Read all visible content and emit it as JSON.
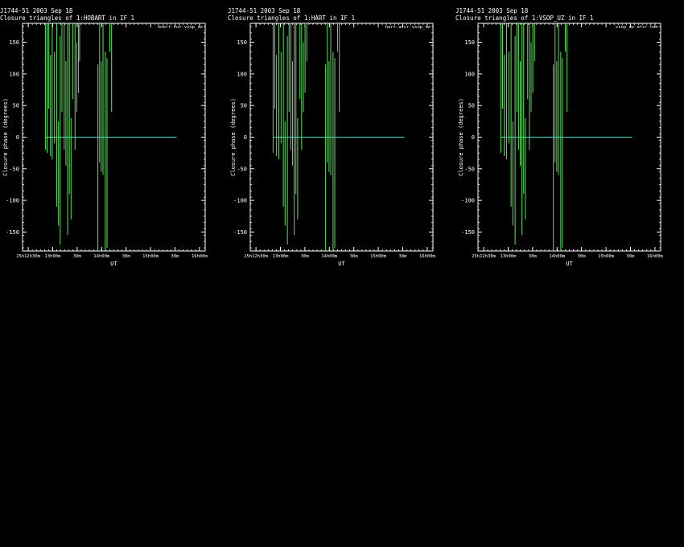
{
  "charts": [
    {
      "source": "J1744-51  2003 Sep 18",
      "title": "Closure triangles of 1:HOBART in IF 1",
      "triangle": "hobrt-rut-vsop_uz"
    },
    {
      "source": "J1744-51  2003 Sep 18",
      "title": "Closure triangles of 1:HART in IF 1",
      "triangle": "hart-atcr-vsop_uz"
    },
    {
      "source": "J1744-51  2003 Sep 18",
      "title": "Closure triangles of 1:VSOP_UZ in IF 1",
      "triangle": "vsop_uz-atcr-hun"
    }
  ],
  "chart_data": [
    {
      "type": "line",
      "xlabel": "UT",
      "ylabel": "Closure phase  (degrees)",
      "x_tick_labels": [
        "25h12h30m",
        "13h00m",
        "30m",
        "14h00m",
        "30m",
        "15h00m",
        "30m",
        "16h00m"
      ],
      "y_ticks": [
        150,
        100,
        50,
        0,
        -50,
        -100,
        -150
      ],
      "ylim": [
        -180,
        180
      ],
      "xlim": [
        -0.1,
        3.1
      ],
      "model_line": {
        "x": [
          0.3,
          2.6
        ],
        "y": [
          0,
          0
        ],
        "color": "#40e0d0"
      },
      "series": [
        {
          "color": "#5ce05c",
          "segments": [
            [
              0.3,
              -20,
              180
            ],
            [
              0.33,
              180,
              -25
            ],
            [
              0.36,
              45,
              180
            ],
            [
              0.39,
              130,
              -30
            ],
            [
              0.42,
              180,
              -35
            ],
            [
              0.46,
              135,
              -10
            ],
            [
              0.5,
              180,
              -110
            ],
            [
              0.53,
              25,
              -140
            ],
            [
              0.56,
              160,
              -170
            ],
            [
              0.59,
              180,
              40
            ],
            [
              0.63,
              180,
              -20
            ],
            [
              0.66,
              120,
              -45
            ],
            [
              0.69,
              180,
              -155
            ],
            [
              0.72,
              180,
              -90
            ],
            [
              0.75,
              30,
              -130
            ],
            [
              0.78,
              180,
              60
            ],
            [
              0.82,
              180,
              -20
            ],
            [
              0.85,
              150,
              40
            ],
            [
              0.88,
              180,
              70
            ],
            [
              0.9,
              180,
              120
            ],
            [
              1.22,
              115,
              -180
            ],
            [
              1.25,
              -40,
              180
            ],
            [
              1.28,
              120,
              -55
            ],
            [
              1.31,
              -60,
              180
            ],
            [
              1.35,
              135,
              -180
            ],
            [
              1.38,
              125,
              -175
            ],
            [
              1.43,
              135,
              180
            ],
            [
              1.46,
              180,
              40
            ]
          ]
        }
      ]
    },
    {
      "type": "line",
      "xlabel": "UT",
      "ylabel": "Closure phase  (degrees)",
      "x_tick_labels": [
        "25h12h30m",
        "13h00m",
        "30m",
        "14h00m",
        "30m",
        "15h00m",
        "30m",
        "16h00m"
      ],
      "y_ticks": [
        150,
        100,
        50,
        0,
        -50,
        -100,
        -150
      ],
      "ylim": [
        -180,
        180
      ],
      "xlim": [
        -0.1,
        3.1
      ],
      "model_line": {
        "x": [
          0.3,
          2.6
        ],
        "y": [
          0,
          0
        ],
        "color": "#40e0d0"
      },
      "series": [
        {
          "color": "#5ce05c",
          "segments": [
            [
              0.3,
              180,
              -25
            ],
            [
              0.33,
              45,
              180
            ],
            [
              0.36,
              130,
              -30
            ],
            [
              0.4,
              180,
              -35
            ],
            [
              0.44,
              135,
              -10
            ],
            [
              0.48,
              180,
              -110
            ],
            [
              0.51,
              25,
              -140
            ],
            [
              0.55,
              160,
              -170
            ],
            [
              0.58,
              180,
              40
            ],
            [
              0.61,
              180,
              -20
            ],
            [
              0.64,
              120,
              -45
            ],
            [
              0.67,
              180,
              -155
            ],
            [
              0.7,
              180,
              -90
            ],
            [
              0.73,
              30,
              -130
            ],
            [
              0.77,
              180,
              60
            ],
            [
              0.8,
              180,
              -20
            ],
            [
              0.83,
              150,
              40
            ],
            [
              0.86,
              180,
              70
            ],
            [
              0.89,
              180,
              120
            ],
            [
              1.22,
              115,
              -180
            ],
            [
              1.25,
              -40,
              180
            ],
            [
              1.28,
              120,
              -55
            ],
            [
              1.31,
              -60,
              180
            ],
            [
              1.35,
              135,
              -180
            ],
            [
              1.38,
              125,
              -175
            ],
            [
              1.43,
              135,
              180
            ],
            [
              1.46,
              180,
              40
            ]
          ]
        }
      ]
    },
    {
      "type": "line",
      "xlabel": "UT",
      "ylabel": "Closure phase  (degrees)",
      "x_tick_labels": [
        "25h12h30m",
        "13h00m",
        "30m",
        "14h00m",
        "30m",
        "15h00m",
        "30m",
        "16h00m"
      ],
      "y_ticks": [
        150,
        100,
        50,
        0,
        -50,
        -100,
        -150
      ],
      "ylim": [
        -180,
        180
      ],
      "xlim": [
        -0.1,
        3.1
      ],
      "model_line": {
        "x": [
          0.3,
          2.6
        ],
        "y": [
          0,
          0
        ],
        "color": "#40e0d0"
      },
      "series": [
        {
          "color": "#5ce05c",
          "segments": [
            [
              0.3,
              180,
              -25
            ],
            [
              0.33,
              45,
              180
            ],
            [
              0.36,
              130,
              -30
            ],
            [
              0.4,
              180,
              -35
            ],
            [
              0.44,
              135,
              -10
            ],
            [
              0.48,
              180,
              -110
            ],
            [
              0.51,
              25,
              -140
            ],
            [
              0.55,
              160,
              -170
            ],
            [
              0.58,
              180,
              40
            ],
            [
              0.61,
              180,
              -20
            ],
            [
              0.64,
              120,
              -45
            ],
            [
              0.67,
              180,
              -155
            ],
            [
              0.7,
              180,
              -90
            ],
            [
              0.73,
              30,
              -130
            ],
            [
              0.77,
              180,
              60
            ],
            [
              0.8,
              180,
              -20
            ],
            [
              0.83,
              150,
              40
            ],
            [
              0.86,
              180,
              70
            ],
            [
              0.89,
              180,
              120
            ],
            [
              1.22,
              115,
              -180
            ],
            [
              1.25,
              -40,
              180
            ],
            [
              1.28,
              120,
              -55
            ],
            [
              1.31,
              -60,
              180
            ],
            [
              1.35,
              135,
              -180
            ],
            [
              1.38,
              125,
              -175
            ],
            [
              1.43,
              135,
              180
            ],
            [
              1.46,
              180,
              40
            ]
          ]
        }
      ]
    }
  ]
}
